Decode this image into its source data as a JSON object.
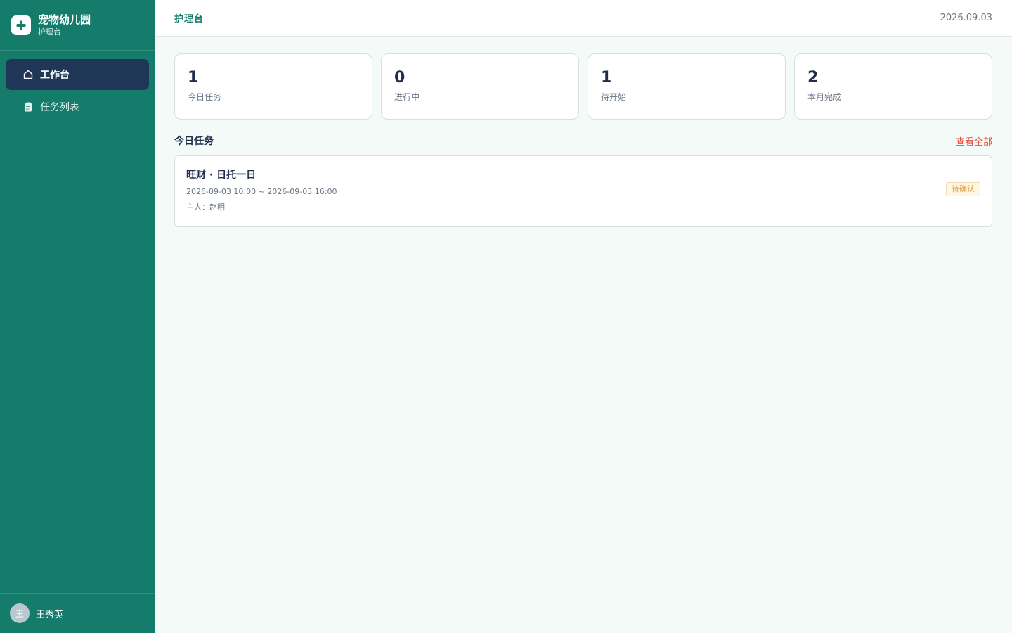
{
  "sidebar": {
    "brand_title": "宠物幼儿园",
    "brand_subtitle": "护理台",
    "items": [
      {
        "label": "工作台",
        "icon": "home-icon",
        "active": true
      },
      {
        "label": "任务列表",
        "icon": "clipboard-icon",
        "active": false
      }
    ],
    "user": {
      "avatar_initial": "王",
      "name": "王秀英"
    }
  },
  "header": {
    "title": "护理台",
    "date": "2026.09.03"
  },
  "stats": [
    {
      "value": "1",
      "label": "今日任务"
    },
    {
      "value": "0",
      "label": "进行中"
    },
    {
      "value": "1",
      "label": "待开始"
    },
    {
      "value": "2",
      "label": "本月完成"
    }
  ],
  "section": {
    "title": "今日任务",
    "view_all": "查看全部"
  },
  "tasks": [
    {
      "title": "旺财 · 日托一日",
      "time": "2026-09-03 10:00 ~ 2026-09-03 16:00",
      "owner": "主人：赵明",
      "status": "待确认"
    }
  ],
  "colors": {
    "sidebar": "#157c6c",
    "active_nav": "#1f3657",
    "accent": "#157c6c",
    "link": "#e0503e",
    "badge_text": "#e2a13b"
  }
}
